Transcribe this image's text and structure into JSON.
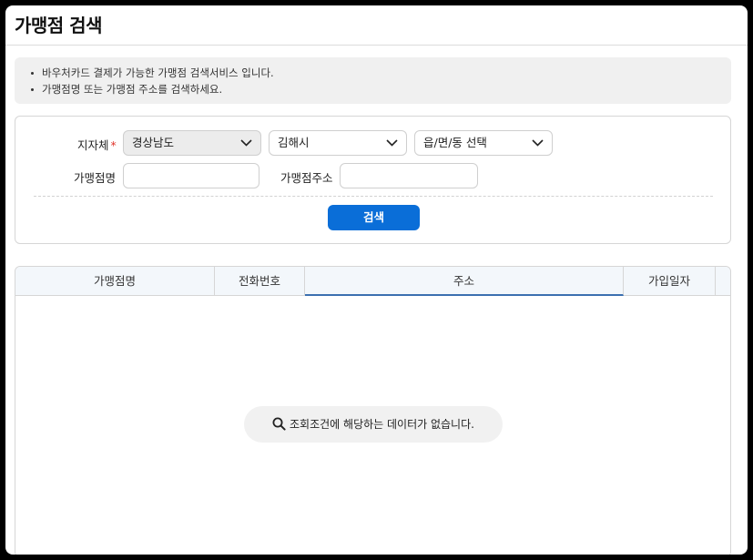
{
  "page": {
    "title": "가맹점 검색"
  },
  "info": {
    "lines": [
      "바우처카드 결제가 가능한 가맹점 검색서비스 입니다.",
      "가맹점명 또는 가맹점 주소를 검색하세요."
    ]
  },
  "search": {
    "region_label": "지자체",
    "required_mark": "*",
    "province_value": "경상남도",
    "city_value": "김해시",
    "district_value": "읍/면/동 선택",
    "store_name_label": "가맹점명",
    "store_name_value": "",
    "store_address_label": "가맹점주소",
    "store_address_value": "",
    "button_label": "검색"
  },
  "results": {
    "columns": [
      "가맹점명",
      "전화번호",
      "주소",
      "가입일자"
    ],
    "empty_message": "조회조건에 해당하는 데이터가 없습니다.",
    "rows": []
  },
  "colors": {
    "accent": "#0a6ed8",
    "required": "#e0352b",
    "table_header_bg": "#f3f7fb"
  }
}
